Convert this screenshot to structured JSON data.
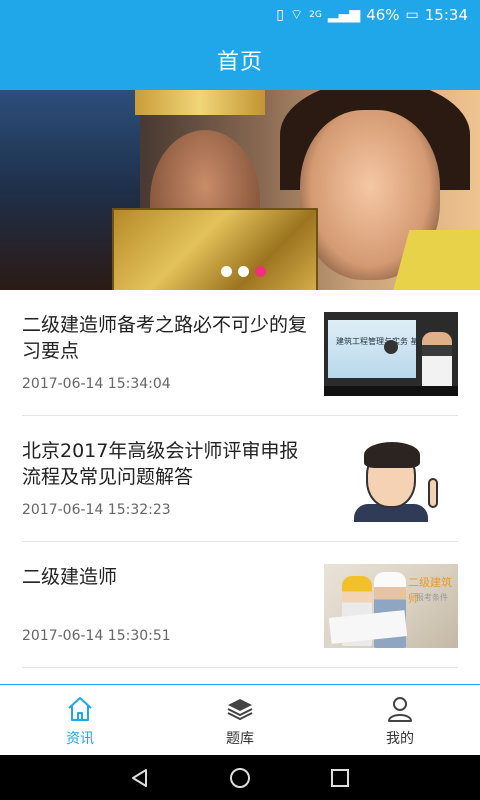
{
  "status_bar": {
    "network": "2G",
    "battery": "46%",
    "time": "15:34"
  },
  "header": {
    "title": "首页"
  },
  "banner": {
    "dots": [
      false,
      false,
      true
    ]
  },
  "news": [
    {
      "title": "二级建造师备考之路必不可少的复习要点",
      "time": "2017-06-14 15:34:04",
      "thumb_text": "建筑工程管理与实务 基础班"
    },
    {
      "title": "北京2017年高级会计师评审申报流程及常见问题解答",
      "time": "2017-06-14 15:32:23"
    },
    {
      "title": "二级建造师",
      "time": "2017-06-14 15:30:51",
      "thumb_text": "二级建筑师",
      "thumb_sub": "报考条件"
    }
  ],
  "tabs": [
    {
      "label": "资讯",
      "icon": "home-icon",
      "active": true
    },
    {
      "label": "题库",
      "icon": "layers-icon",
      "active": false
    },
    {
      "label": "我的",
      "icon": "user-icon",
      "active": false
    }
  ],
  "colors": {
    "accent": "#1fa7ea",
    "dot_active": "#f0307a"
  }
}
